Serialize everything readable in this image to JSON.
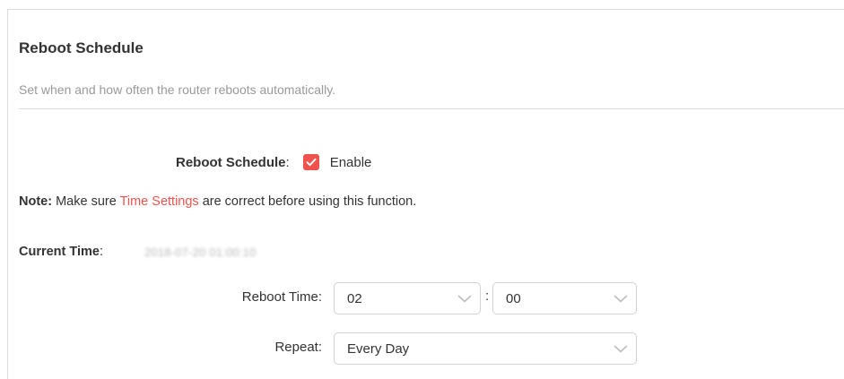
{
  "section": {
    "title": "Reboot Schedule",
    "description": "Set when and how often the router reboots automatically."
  },
  "reboot_schedule": {
    "label": "Reboot Schedule",
    "label_suffix": ":",
    "checkbox_checked": true,
    "checkbox_label": "Enable"
  },
  "note": {
    "prefix": "Note:",
    "text_before": " Make sure ",
    "link_text": "Time Settings",
    "text_after": " are correct before using this function."
  },
  "current_time": {
    "label": "Current Time",
    "label_suffix": ":",
    "value": "2018-07-20 01:00:10"
  },
  "reboot_time": {
    "label": "Reboot Time:",
    "hour": "02",
    "separator": ":",
    "minute": "00"
  },
  "repeat": {
    "label": "Repeat:",
    "value": "Every Day"
  },
  "colors": {
    "accent": "#f0534e",
    "text": "#333333",
    "muted": "#999999",
    "border": "#d3d3d3"
  }
}
